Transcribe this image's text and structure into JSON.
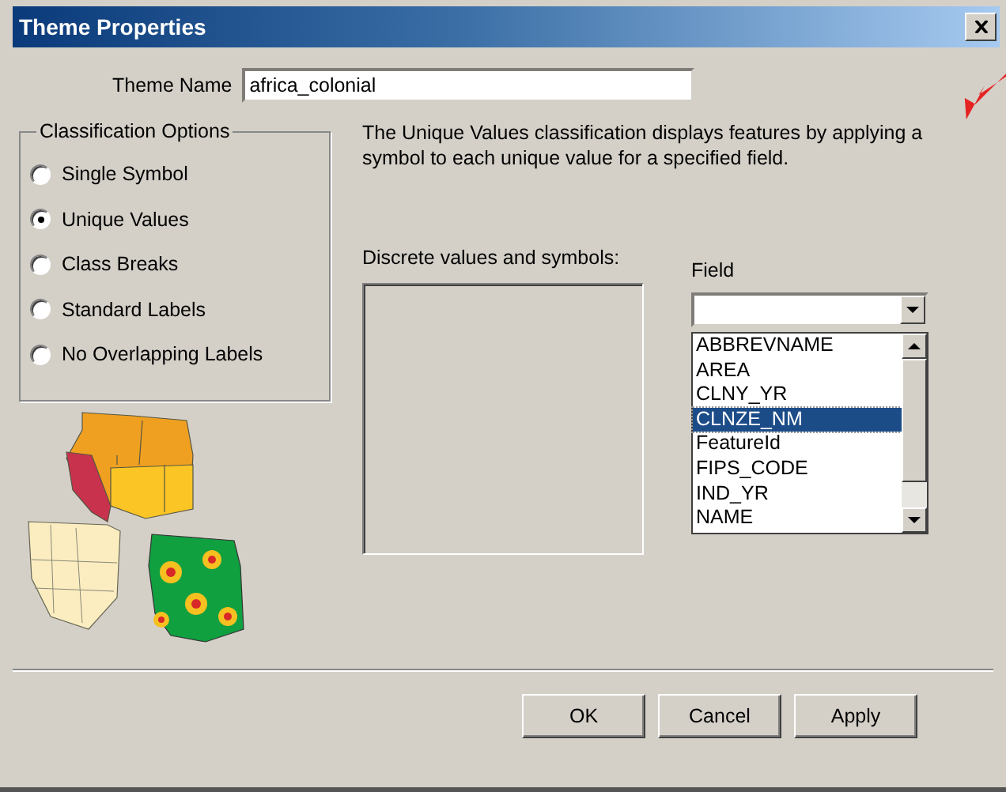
{
  "window": {
    "title": "Theme Properties"
  },
  "theme_name": {
    "label": "Theme Name",
    "value": "africa_colonial"
  },
  "classification_options": {
    "title": "Classification Options",
    "options": [
      {
        "label": "Single Symbol",
        "selected": false
      },
      {
        "label": "Unique Values",
        "selected": true
      },
      {
        "label": "Class Breaks",
        "selected": false
      },
      {
        "label": "Standard Labels",
        "selected": false
      },
      {
        "label": "No Overlapping Labels",
        "selected": false
      }
    ]
  },
  "description": "The Unique Values classification displays features by applying a symbol to each unique value for a specified field.",
  "discrete_values": {
    "label": "Discrete values and symbols:"
  },
  "field": {
    "label": "Field",
    "items": [
      {
        "label": "ABBREVNAME",
        "selected": false
      },
      {
        "label": "AREA",
        "selected": false
      },
      {
        "label": "CLNY_YR",
        "selected": false
      },
      {
        "label": "CLNZE_NM",
        "selected": true
      },
      {
        "label": "FeatureId",
        "selected": false
      },
      {
        "label": "FIPS_CODE",
        "selected": false
      },
      {
        "label": "IND_YR",
        "selected": false
      },
      {
        "label": "NAME",
        "selected": false
      }
    ]
  },
  "buttons": [
    "OK",
    "Cancel",
    "Apply"
  ]
}
